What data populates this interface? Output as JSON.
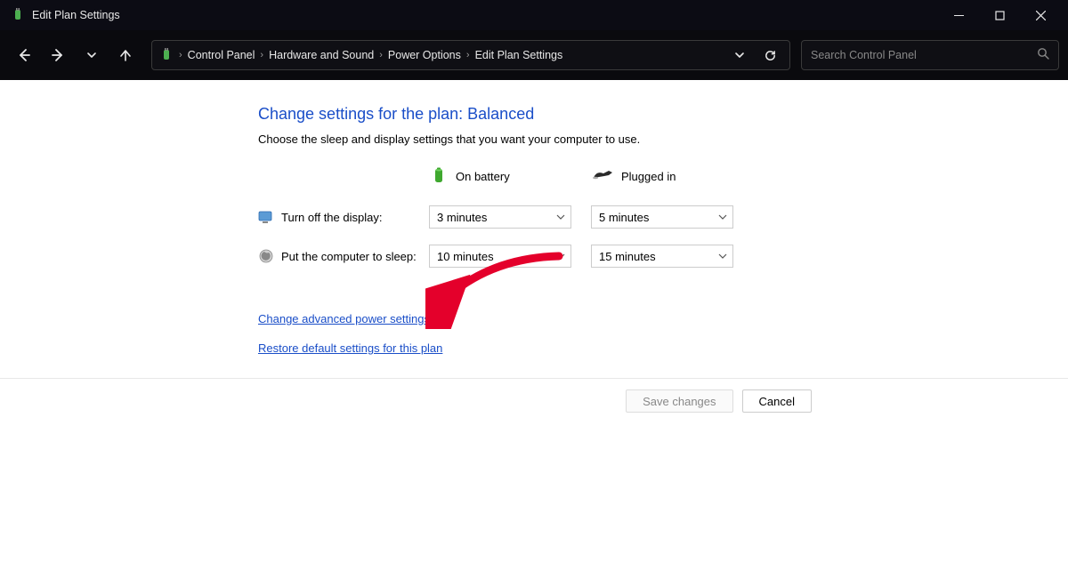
{
  "titlebar": {
    "title": "Edit Plan Settings"
  },
  "breadcrumb": {
    "items": [
      "Control Panel",
      "Hardware and Sound",
      "Power Options",
      "Edit Plan Settings"
    ]
  },
  "search": {
    "placeholder": "Search Control Panel"
  },
  "page": {
    "heading": "Change settings for the plan: Balanced",
    "subtext": "Choose the sleep and display settings that you want your computer to use.",
    "column_headers": {
      "battery": "On battery",
      "plugged": "Plugged in"
    },
    "rows": {
      "display": {
        "label": "Turn off the display:",
        "battery": "3 minutes",
        "plugged": "5 minutes"
      },
      "sleep": {
        "label": "Put the computer to sleep:",
        "battery": "10 minutes",
        "plugged": "15 minutes"
      }
    },
    "links": {
      "advanced": "Change advanced power settings",
      "restore": "Restore default settings for this plan"
    },
    "buttons": {
      "save": "Save changes",
      "cancel": "Cancel"
    }
  }
}
